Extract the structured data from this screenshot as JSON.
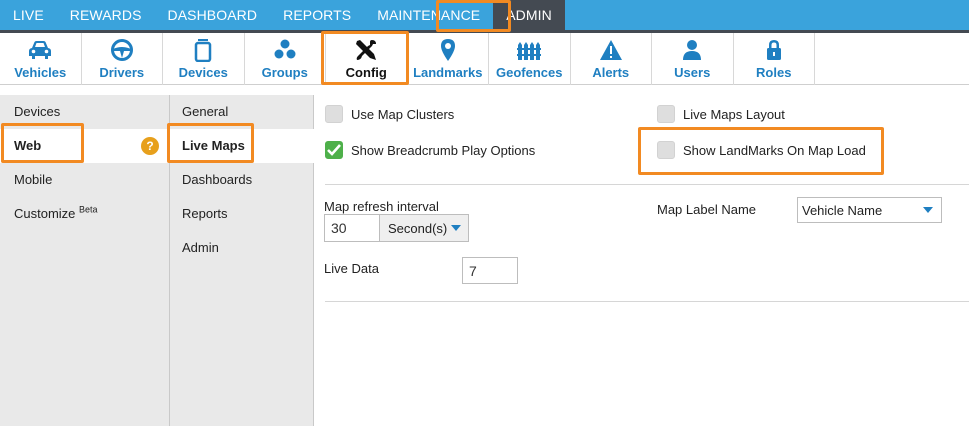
{
  "topnav": {
    "items": [
      {
        "label": "LIVE"
      },
      {
        "label": "REWARDS"
      },
      {
        "label": "DASHBOARD"
      },
      {
        "label": "REPORTS"
      },
      {
        "label": "MAINTENANCE"
      },
      {
        "label": "ADMIN",
        "active": true
      }
    ]
  },
  "toolbar": {
    "items": [
      {
        "label": "Vehicles",
        "icon": "car-icon"
      },
      {
        "label": "Drivers",
        "icon": "steering-wheel-icon"
      },
      {
        "label": "Devices",
        "icon": "device-icon"
      },
      {
        "label": "Groups",
        "icon": "groups-icon"
      },
      {
        "label": "Config",
        "icon": "tools-icon",
        "active": true
      },
      {
        "label": "Landmarks",
        "icon": "map-pin-icon"
      },
      {
        "label": "Geofences",
        "icon": "fence-icon"
      },
      {
        "label": "Alerts",
        "icon": "warning-icon"
      },
      {
        "label": "Users",
        "icon": "user-icon"
      },
      {
        "label": "Roles",
        "icon": "lock-icon"
      }
    ],
    "accent": "#1f7fc1"
  },
  "menu1": {
    "items": [
      "Devices",
      "Web",
      "Mobile",
      "Customize"
    ],
    "customize_sup": "Beta",
    "help_badge": "?"
  },
  "menu2": {
    "items": [
      "General",
      "Live Maps",
      "Dashboards",
      "Reports",
      "Admin"
    ]
  },
  "content": {
    "use_map_clusters": {
      "label": "Use Map Clusters",
      "checked": false
    },
    "live_maps_layout": {
      "label": "Live Maps Layout",
      "checked": false
    },
    "breadcrumb_play": {
      "label": "Show Breadcrumb Play Options",
      "checked": true
    },
    "show_landmarks": {
      "label": "Show LandMarks On Map Load",
      "checked": false
    },
    "refresh_label": "Map refresh interval",
    "refresh_value": "30",
    "refresh_unit": "Second(s)",
    "map_label_name": "Map Label Name",
    "map_label_value": "Vehicle Name",
    "live_data_label": "Live Data",
    "live_data_value": "7"
  },
  "colors": {
    "topbar": "#3aa3dc",
    "active_tab": "#444a52",
    "highlight": "#f28a22",
    "checked": "#4eb04a",
    "help_badge": "#e7a01c"
  }
}
